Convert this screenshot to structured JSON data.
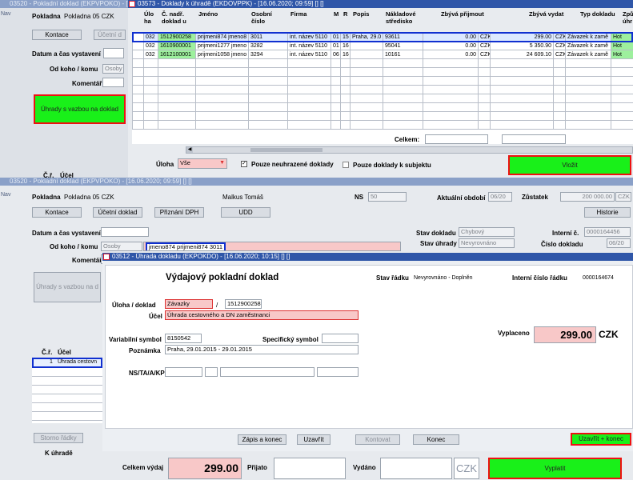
{
  "w1": {
    "title": "03520 - Pokladní doklad (EKPVPOKO) - [16.06.2020; 09:59] [] []",
    "nav": "Nav",
    "pokladna_label": "Pokladna",
    "pokladna_value": "Pokladna 05 CZK",
    "kontace": "Kontace",
    "ucetni": "Účetní d",
    "datum_label": "Datum a čas vystavení",
    "odkoho_label": "Od koho / komu",
    "odkoho_value": "Osoby",
    "komentar_label": "Komentář",
    "uhrady_btn": "Úhrady s vazbou na doklad",
    "cz_label": "Č.ř.",
    "ucel_label": "Účel"
  },
  "w2": {
    "title": "03573 - Doklady k úhradě (EKDOVPPK) - [16.06.2020; 09:59] [] []",
    "columns": [
      "Úlo ha",
      "Č. nadř. doklad u",
      "Jméno",
      "Osobní číslo",
      "Firma",
      "M",
      "R",
      "Popis",
      "Nákladové středisko",
      "Zbývá přijmout",
      "Zbývá vydat",
      "Typ dokladu",
      "Způ úhr"
    ],
    "rows": [
      {
        "uloha": "032",
        "doklad": "1512900258",
        "jmeno": "prijmeni874 jmeno8",
        "cislo": "3011",
        "firma": "int. název 5110",
        "m": "01",
        "r": "15",
        "popis": "Praha, 29.0",
        "str": "93611",
        "prijmout": "0.00",
        "m1": "CZK",
        "vydat": "299.00",
        "m2": "CZK",
        "typ": "Závazek k zamě",
        "zp": "Hot"
      },
      {
        "uloha": "032",
        "doklad": "1610900001",
        "jmeno": "prijmeni1277 jmeno",
        "cislo": "3282",
        "firma": "int. název 5110",
        "m": "01",
        "r": "16",
        "popis": "",
        "str": "95041",
        "prijmout": "0.00",
        "m1": "CZK",
        "vydat": "5 350.90",
        "m2": "CZK",
        "typ": "Závazek k zamě",
        "zp": "Hot"
      },
      {
        "uloha": "032",
        "doklad": "1612100001",
        "jmeno": "prijmeni1058 jmeno",
        "cislo": "3294",
        "firma": "int. název 5110",
        "m": "06",
        "r": "16",
        "popis": "",
        "str": "10161",
        "prijmout": "0.00",
        "m1": "CZK",
        "vydat": "24 609.10",
        "m2": "CZK",
        "typ": "Závazek k zamě",
        "zp": "Hot"
      }
    ],
    "celkem_label": "Celkem:",
    "uloha_label": "Úloha",
    "uloha_value": "Vše",
    "pouze_neuhrazene": "Pouze neuhrazené doklady",
    "pouze_subjekt": "Pouze doklady k subjektu",
    "vlozit": "Vložit"
  },
  "w3": {
    "title": "03520 - Pokladní doklad (EKPVPOKO) - [16.06.2020; 09:59] [] []",
    "nav": "Nav",
    "pokladna_label": "Pokladna",
    "pokladna_value": "Pokladna 05 CZK",
    "user": "Malkus Tomáš",
    "ns_label": "NS",
    "ns_value": "50",
    "obdobi_label": "Aktuální období",
    "obdobi_value": "06/20",
    "zustatek_label": "Zůstatek",
    "zustatek_value": "200 000.00",
    "zustatek_cur": "CZK",
    "btn_kontace": "Kontace",
    "btn_ucetni": "Účetní doklad",
    "btn_dph": "Přiznání DPH",
    "btn_udd": "UDD",
    "btn_historie": "Historie",
    "datum_label": "Datum a čas vystavení",
    "odkoho_label": "Od koho / komu",
    "odkoho_type": "Osoby",
    "odkoho_value": "jmeno874 prijmeni874 3011",
    "komentar_label": "Komentář",
    "stav_dokladu_label": "Stav dokladu",
    "stav_dokladu_value": "Chybový",
    "stav_uhrady_label": "Stav úhrady",
    "stav_uhrady_value": "Nevyrovnáno",
    "interni_label": "Interní č.",
    "interni_value": "0000164456",
    "cislo_label": "Číslo dokladu",
    "cislo_value": "06/20",
    "uhrady_btn": "Úhrady s vazbou na d",
    "cz_label": "Č.ř.",
    "ucel_label": "Účel",
    "row1_num": "1",
    "row1_ucel": "Úhrada cestovn",
    "storno": "Storno řádky",
    "k_uhrade": "K úhradě",
    "celkem_vydaj_label": "Celkem výdaj",
    "celkem_vydaj_value": "299.00",
    "prijato_label": "Přijato",
    "vydano_label": "Vydáno",
    "czk": "CZK",
    "vyplatit": "Vyplatit"
  },
  "w4": {
    "title": "03512 - Úhrada dokladu (EKPOKDO) - [16.06.2020; 10:15] [] []",
    "heading": "Výdajový pokladní doklad",
    "stav_radku_label": "Stav řádku",
    "stav_radku_value": "Nevyrovnáno - Doplněn",
    "interni_radku_label": "Interní číslo řádku",
    "interni_radku_value": "0000164674",
    "uloha_label": "Úloha / doklad",
    "uloha_value": "Závazky",
    "doklad_value": "1512900258",
    "ucel_label": "Účel",
    "ucel_value": "Úhrada cestovného a DN zaměstnanci",
    "vs_label": "Variabilní symbol",
    "vs_value": "8150542",
    "ss_label": "Specifický symbol",
    "poznamka_label": "Poznámka",
    "poznamka_value": "Praha, 29.01.2015 - 29.01.2015",
    "ns_label": "NS/TA/A/KP",
    "vyplaceno_label": "Vyplaceno",
    "vyplaceno_value": "299.00",
    "vyplaceno_cur": "CZK",
    "btn_zapis": "Zápis a konec",
    "btn_uzavrit": "Uzavřít",
    "btn_kontovat": "Kontovat",
    "btn_konec": "Konec",
    "btn_uzavrit_konec": "Uzavřít + konec"
  }
}
